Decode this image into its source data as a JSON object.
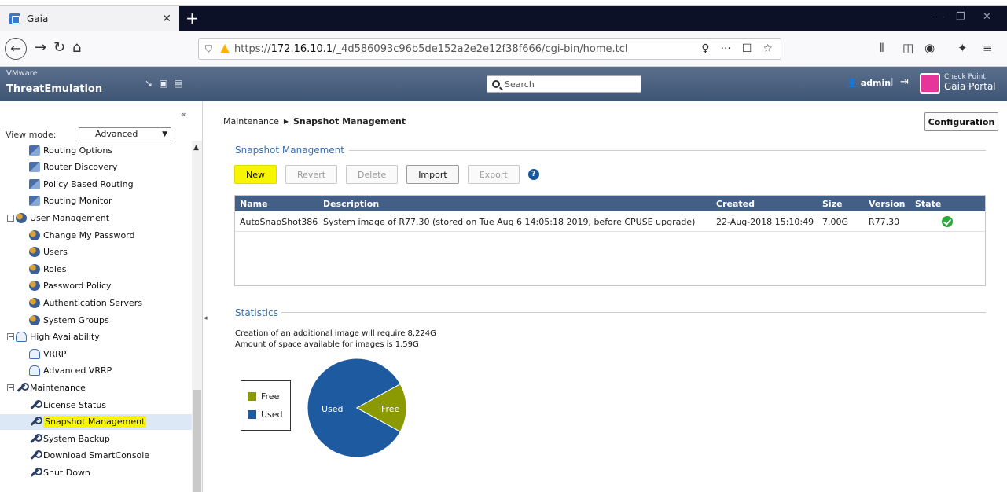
{
  "browser": {
    "tab_title": "Gaia",
    "url_prefix": "https://",
    "url_host": "172.16.10.1",
    "url_path": "/_4d586093c96b5de152a2e2e12f38f666/cgi-bin/home.tcl"
  },
  "header": {
    "brand_top": "VMware",
    "brand_bottom": "ThreatEmulation",
    "search_placeholder": "Search",
    "user": "admin",
    "logo_top": "Check Point",
    "logo_bottom": "Gaia Portal"
  },
  "sidebar": {
    "view_mode_label": "View mode:",
    "view_mode_value": "Advanced",
    "items": [
      {
        "label": "Routing Options",
        "icon": "route-icon",
        "level": 1
      },
      {
        "label": "Router Discovery",
        "icon": "route-icon",
        "level": 1
      },
      {
        "label": "Policy Based Routing",
        "icon": "route-icon",
        "level": 1
      },
      {
        "label": "Routing Monitor",
        "icon": "route-icon",
        "level": 1
      },
      {
        "label": "User Management",
        "icon": "users-icon",
        "level": 0
      },
      {
        "label": "Change My Password",
        "icon": "users-icon",
        "level": 1
      },
      {
        "label": "Users",
        "icon": "users-icon",
        "level": 1
      },
      {
        "label": "Roles",
        "icon": "users-icon",
        "level": 1
      },
      {
        "label": "Password Policy",
        "icon": "users-icon",
        "level": 1
      },
      {
        "label": "Authentication Servers",
        "icon": "users-icon",
        "level": 1
      },
      {
        "label": "System Groups",
        "icon": "users-icon",
        "level": 1
      },
      {
        "label": "High Availability",
        "icon": "cloud-icon",
        "level": 0
      },
      {
        "label": "VRRP",
        "icon": "cloud-icon",
        "level": 1
      },
      {
        "label": "Advanced VRRP",
        "icon": "cloud-icon",
        "level": 1
      },
      {
        "label": "Maintenance",
        "icon": "wrench-icon",
        "level": 0
      },
      {
        "label": "License Status",
        "icon": "wrench-icon",
        "level": 1
      },
      {
        "label": "Snapshot Management",
        "icon": "wrench-icon",
        "level": 1
      },
      {
        "label": "System Backup",
        "icon": "wrench-icon",
        "level": 1
      },
      {
        "label": "Download SmartConsole",
        "icon": "wrench-icon",
        "level": 1
      },
      {
        "label": "Shut Down",
        "icon": "wrench-icon",
        "level": 1
      }
    ]
  },
  "main": {
    "breadcrumb_parent": "Maintenance",
    "breadcrumb_current": "Snapshot Management",
    "config_button": "Configuration",
    "section_title": "Snapshot Management",
    "buttons": {
      "new": "New",
      "revert": "Revert",
      "delete": "Delete",
      "import": "Import",
      "export": "Export"
    },
    "table": {
      "columns": [
        "Name",
        "Description",
        "Created",
        "Size",
        "Version",
        "State"
      ],
      "rows": [
        {
          "name": "AutoSnapShot386",
          "description": "System image of R77.30 (stored on Tue Aug 6 14:05:18 2019, before CPUSE upgrade)",
          "created": "22-Aug-2018 15:10:49",
          "size": "7.00G",
          "version": "R77.30",
          "state": "ok"
        }
      ]
    },
    "statistics": {
      "title": "Statistics",
      "line1": "Creation of an additional image will require 8.224G",
      "line2": "Amount of space available for images is 1.59G",
      "legend": [
        {
          "label": "Free",
          "color": "#8a9a00"
        },
        {
          "label": "Used",
          "color": "#1e5aa0"
        }
      ],
      "pie_labels": {
        "used": "Used",
        "free": "Free"
      },
      "free_fraction": 0.16
    }
  }
}
